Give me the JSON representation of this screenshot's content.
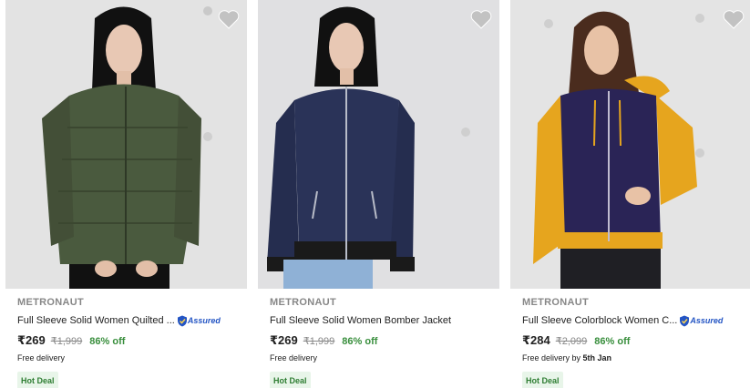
{
  "products": [
    {
      "brand": "METRONAUT",
      "title": "Full Sleeve Solid Women Quilted ...",
      "assured": true,
      "assured_label": "Assured",
      "price": "₹269",
      "mrp": "₹1,999",
      "discount": "86% off",
      "delivery": "Free delivery",
      "delivery_date": "",
      "badge": "Hot Deal",
      "wishlist_icon": "heart-icon",
      "jacket_color": "#4a5a3e"
    },
    {
      "brand": "METRONAUT",
      "title": "Full Sleeve Solid Women Bomber Jacket",
      "assured": false,
      "assured_label": "",
      "price": "₹269",
      "mrp": "₹1,999",
      "discount": "86% off",
      "delivery": "Free delivery",
      "delivery_date": "",
      "badge": "Hot Deal",
      "wishlist_icon": "heart-icon",
      "jacket_color": "#2a3358"
    },
    {
      "brand": "METRONAUT",
      "title": "Full Sleeve Colorblock Women C...",
      "assured": true,
      "assured_label": "Assured",
      "price": "₹284",
      "mrp": "₹2,099",
      "discount": "86% off",
      "delivery": "Free delivery by ",
      "delivery_date": "5th Jan",
      "badge": "Hot Deal",
      "wishlist_icon": "heart-icon",
      "jacket_color": "#2a2456"
    }
  ],
  "colors": {
    "discount": "#388e3c",
    "assured": "#2455c4",
    "badge_bg": "#e8f5e9",
    "badge_text": "#2e7d32",
    "muted": "#878787"
  }
}
